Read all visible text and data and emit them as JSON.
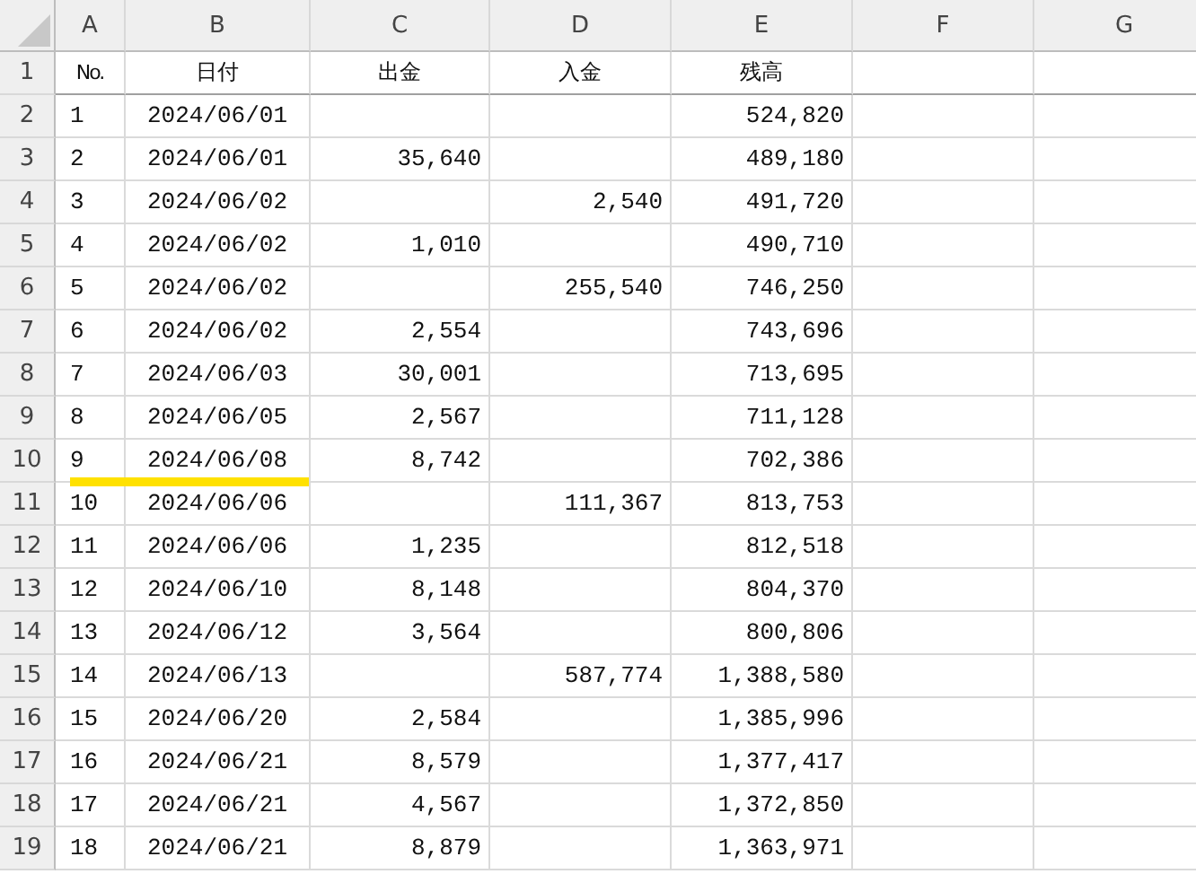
{
  "column_headers": [
    "A",
    "B",
    "C",
    "D",
    "E",
    "F",
    "G"
  ],
  "header_row": {
    "row": "1",
    "cells": [
      "No.",
      "日付",
      "出金",
      "入金",
      "残高"
    ]
  },
  "rows": [
    {
      "row": "2",
      "no": "1",
      "date": "2024/06/01",
      "balance": "524,820",
      "underlined": false
    },
    {
      "row": "3",
      "no": "2",
      "date": "2024/06/01",
      "withdrawal": "35,640",
      "balance": "489,180",
      "underlined": false
    },
    {
      "row": "4",
      "no": "3",
      "date": "2024/06/02",
      "deposit": "2,540",
      "balance": "491,720",
      "underlined": false
    },
    {
      "row": "5",
      "no": "4",
      "date": "2024/06/02",
      "withdrawal": "1,010",
      "balance": "490,710",
      "underlined": false
    },
    {
      "row": "6",
      "no": "5",
      "date": "2024/06/02",
      "deposit": "255,540",
      "balance": "746,250",
      "underlined": false
    },
    {
      "row": "7",
      "no": "6",
      "date": "2024/06/02",
      "withdrawal": "2,554",
      "balance": "743,696",
      "underlined": false
    },
    {
      "row": "8",
      "no": "7",
      "date": "2024/06/03",
      "withdrawal": "30,001",
      "balance": "713,695",
      "underlined": false
    },
    {
      "row": "9",
      "no": "8",
      "date": "2024/06/05",
      "withdrawal": "2,567",
      "balance": "711,128",
      "underlined": false
    },
    {
      "row": "10",
      "no": "9",
      "date": "2024/06/08",
      "withdrawal": "8,742",
      "balance": "702,386",
      "underlined": true
    },
    {
      "row": "11",
      "no": "10",
      "date": "2024/06/06",
      "deposit": "111,367",
      "balance": "813,753",
      "underlined": false
    },
    {
      "row": "12",
      "no": "11",
      "date": "2024/06/06",
      "withdrawal": "1,235",
      "balance": "812,518",
      "underlined": false
    },
    {
      "row": "13",
      "no": "12",
      "date": "2024/06/10",
      "withdrawal": "8,148",
      "balance": "804,370",
      "underlined": false
    },
    {
      "row": "14",
      "no": "13",
      "date": "2024/06/12",
      "withdrawal": "3,564",
      "balance": "800,806",
      "underlined": false
    },
    {
      "row": "15",
      "no": "14",
      "date": "2024/06/13",
      "deposit": "587,774",
      "balance": "1,388,580",
      "underlined": false
    },
    {
      "row": "16",
      "no": "15",
      "date": "2024/06/20",
      "withdrawal": "2,584",
      "balance": "1,385,996",
      "underlined": false
    },
    {
      "row": "17",
      "no": "16",
      "date": "2024/06/21",
      "withdrawal": "8,579",
      "balance": "1,377,417",
      "underlined": false
    },
    {
      "row": "18",
      "no": "17",
      "date": "2024/06/21",
      "withdrawal": "4,567",
      "balance": "1,372,850",
      "underlined": false
    },
    {
      "row": "19",
      "no": "18",
      "date": "2024/06/21",
      "withdrawal": "8,879",
      "balance": "1,363,971",
      "underlined": false
    }
  ]
}
